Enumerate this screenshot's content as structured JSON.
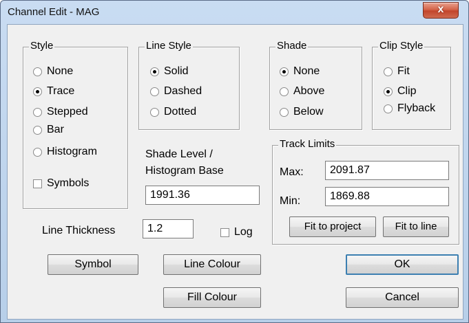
{
  "window": {
    "title": "Channel Edit - MAG",
    "close_label": "x"
  },
  "style_group": {
    "legend": "Style",
    "options": [
      {
        "label": "None",
        "selected": false
      },
      {
        "label": "Trace",
        "selected": true
      },
      {
        "label": "Stepped",
        "selected": false
      },
      {
        "label": "Bar",
        "selected": false
      },
      {
        "label": "Histogram",
        "selected": false
      }
    ],
    "symbols_label": "Symbols",
    "symbols_checked": false
  },
  "line_style_group": {
    "legend": "Line Style",
    "options": [
      {
        "label": "Solid",
        "selected": true
      },
      {
        "label": "Dashed",
        "selected": false
      },
      {
        "label": "Dotted",
        "selected": false
      }
    ]
  },
  "shade_group": {
    "legend": "Shade",
    "options": [
      {
        "label": "None",
        "selected": true
      },
      {
        "label": "Above",
        "selected": false
      },
      {
        "label": "Below",
        "selected": false
      }
    ]
  },
  "clip_style_group": {
    "legend": "Clip Style",
    "options": [
      {
        "label": "Fit",
        "selected": false
      },
      {
        "label": "Clip",
        "selected": true
      },
      {
        "label": "Flyback",
        "selected": false
      }
    ]
  },
  "shade_level": {
    "label_line1": "Shade Level /",
    "label_line2": "Histogram Base",
    "value": "1991.36"
  },
  "track_limits": {
    "legend": "Track Limits",
    "max_label": "Max:",
    "max_value": "2091.87",
    "min_label": "Min:",
    "min_value": "1869.88",
    "fit_project_label": "Fit to project",
    "fit_line_label": "Fit to line"
  },
  "line_thickness": {
    "label": "Line Thickness",
    "value": "1.2"
  },
  "log": {
    "label": "Log",
    "checked": false
  },
  "buttons": {
    "symbol": "Symbol",
    "line_colour": "Line Colour",
    "fill_colour": "Fill Colour",
    "ok": "OK",
    "cancel": "Cancel"
  },
  "colors": {
    "face": "#f0f0f0",
    "title_gradient": "#c9dcf2",
    "close_red": "#c2452b",
    "default_border": "#3c7fb1"
  }
}
